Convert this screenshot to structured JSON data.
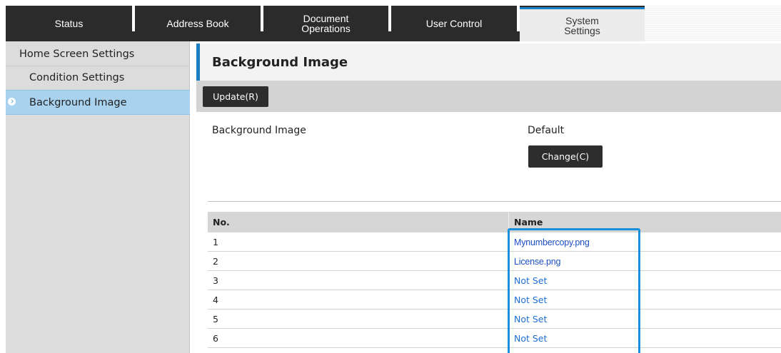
{
  "tabs": [
    {
      "label": "Status",
      "active": false
    },
    {
      "label": "Address Book",
      "active": false
    },
    {
      "label": "Document\nOperations",
      "active": false
    },
    {
      "label": "User Control",
      "active": false
    },
    {
      "label": "System\nSettings",
      "active": true
    }
  ],
  "sidebar": {
    "items": [
      {
        "label": "Home Screen Settings",
        "level": 0,
        "active": false
      },
      {
        "label": "Condition Settings",
        "level": 1,
        "active": false
      },
      {
        "label": "Background Image",
        "level": 1,
        "active": true
      }
    ]
  },
  "main": {
    "title": "Background Image",
    "update_button": "Update(R)",
    "setting": {
      "label": "Background Image",
      "value": "Default",
      "change_button": "Change(C)"
    },
    "table": {
      "columns": [
        "No.",
        "Name"
      ],
      "rows": [
        {
          "no": "1",
          "name": "Mynumbercopy.png",
          "is_file": true
        },
        {
          "no": "2",
          "name": "License.png",
          "is_file": true
        },
        {
          "no": "3",
          "name": "Not Set",
          "is_file": false
        },
        {
          "no": "4",
          "name": "Not Set",
          "is_file": false
        },
        {
          "no": "5",
          "name": "Not Set",
          "is_file": false
        },
        {
          "no": "6",
          "name": "Not Set",
          "is_file": false
        }
      ]
    }
  },
  "colors": {
    "tab_bar": "#2b2b2b",
    "accent": "#1a7fc3",
    "sidebar_active": "#a9d2ee",
    "link": "#1d6fd4",
    "highlight_border": "#1a90dc"
  }
}
